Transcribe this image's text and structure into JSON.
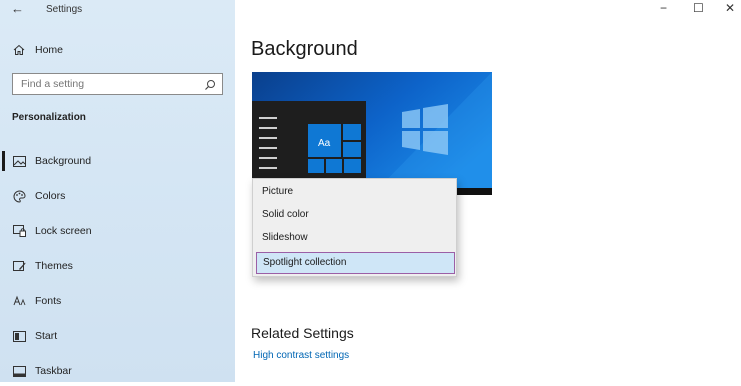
{
  "window": {
    "title": "Settings",
    "controls": {
      "minimize": "−",
      "maximize": "☐",
      "close": "✕"
    }
  },
  "sidebar": {
    "home_label": "Home",
    "search_placeholder": "Find a setting",
    "section_title": "Personalization",
    "items": [
      {
        "label": "Background",
        "icon": "image-icon",
        "selected": true
      },
      {
        "label": "Colors",
        "icon": "palette-icon"
      },
      {
        "label": "Lock screen",
        "icon": "lock-screen-icon"
      },
      {
        "label": "Themes",
        "icon": "themes-icon"
      },
      {
        "label": "Fonts",
        "icon": "fonts-icon"
      },
      {
        "label": "Start",
        "icon": "start-icon"
      },
      {
        "label": "Taskbar",
        "icon": "taskbar-icon"
      }
    ]
  },
  "main": {
    "title": "Background",
    "preview_tile_text": "Aa",
    "dropdown": {
      "options": [
        "Picture",
        "Solid color",
        "Slideshow",
        "Spotlight collection"
      ],
      "highlighted": "Spotlight collection"
    },
    "related": {
      "title": "Related Settings",
      "links": [
        "High contrast settings"
      ]
    }
  },
  "colors": {
    "accent": "#0066b4",
    "highlight_border": "#9b5fa6",
    "highlight_fill": "#cfe6f7"
  }
}
